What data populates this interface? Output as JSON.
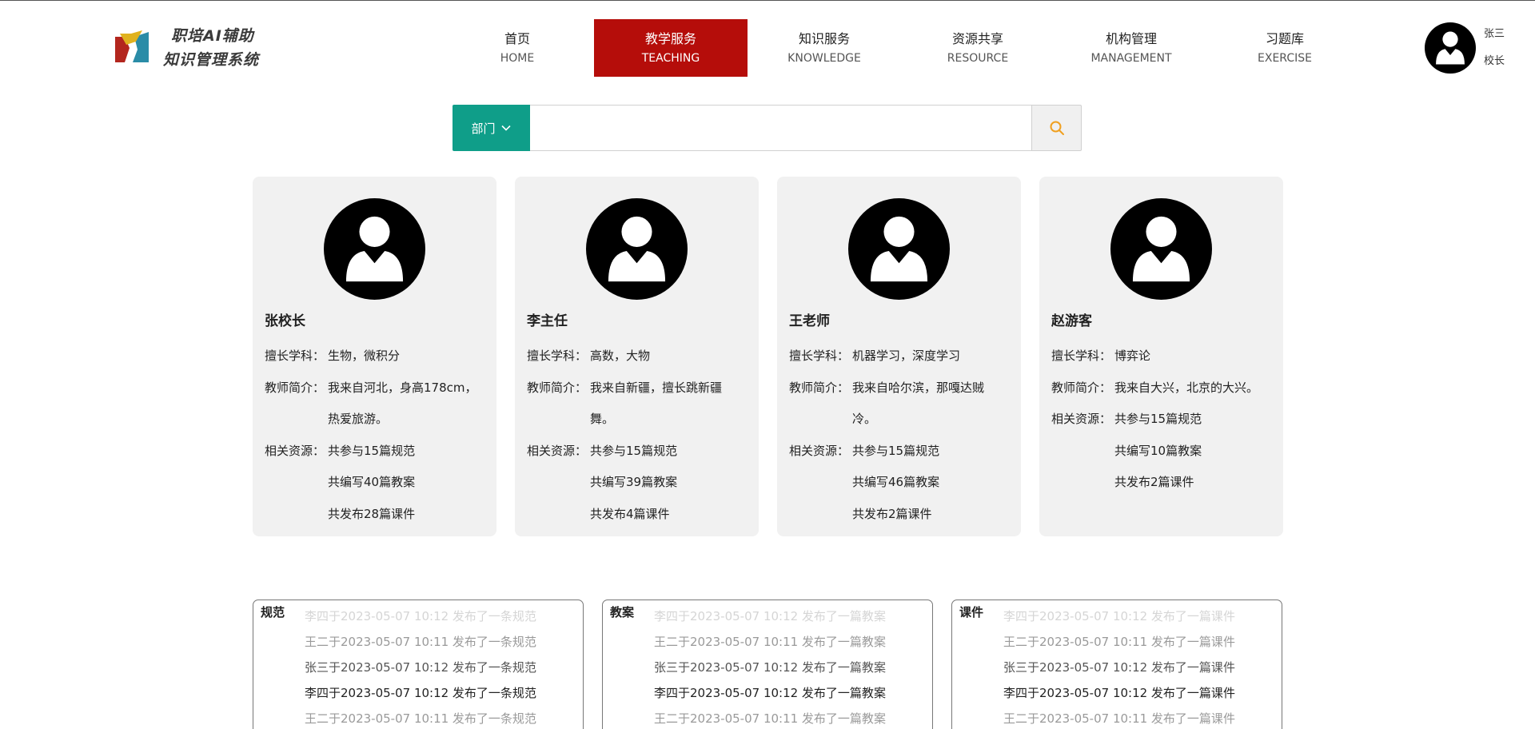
{
  "header": {
    "logo_line1": "职培AI辅助",
    "logo_line2": "知识管理系统",
    "nav": [
      {
        "zh": "首页",
        "en": "HOME"
      },
      {
        "zh": "教学服务",
        "en": "TEACHING",
        "active": true
      },
      {
        "zh": "知识服务",
        "en": "KNOWLEDGE"
      },
      {
        "zh": "资源共享",
        "en": "RESOURCE"
      },
      {
        "zh": "机构管理",
        "en": "MANAGEMENT"
      },
      {
        "zh": "习题库",
        "en": "EXERCISE"
      }
    ],
    "user": {
      "name": "张三",
      "role": "校长"
    }
  },
  "search": {
    "dept_label": "部门",
    "value": "",
    "placeholder": ""
  },
  "teachers": [
    {
      "name": "张校长",
      "subject_label": "擅长学科：",
      "subject": "生物，微积分",
      "intro_label": "教师简介：",
      "intro_lines": [
        "我来自河北，身高178cm，",
        "热爱旅游。"
      ],
      "res_label": "相关资源：",
      "resources": [
        "共参与15篇规范",
        "共编写40篇教案",
        "共发布28篇课件"
      ]
    },
    {
      "name": "李主任",
      "subject_label": "擅长学科：",
      "subject": "高数，大物",
      "intro_label": "教师简介：",
      "intro_lines": [
        "我来自新疆，擅长跳新疆",
        "舞。"
      ],
      "res_label": "相关资源：",
      "resources": [
        "共参与15篇规范",
        "共编写39篇教案",
        "共发布4篇课件"
      ]
    },
    {
      "name": "王老师",
      "subject_label": "擅长学科：",
      "subject": "机器学习，深度学习",
      "intro_label": "教师简介：",
      "intro_lines": [
        "我来自哈尔滨，那嘎达贼",
        "冷。"
      ],
      "res_label": "相关资源：",
      "resources": [
        "共参与15篇规范",
        "共编写46篇教案",
        "共发布2篇课件"
      ]
    },
    {
      "name": "赵游客",
      "subject_label": "擅长学科：",
      "subject": "博弈论",
      "intro_label": "教师简介：",
      "intro_lines": [
        "我来自大兴，北京的大兴。"
      ],
      "res_label": "相关资源：",
      "resources": [
        "共参与15篇规范",
        "共编写10篇教案",
        "共发布2篇课件"
      ]
    }
  ],
  "feeds": [
    {
      "title": "规范",
      "items": [
        "李四于2023-05-07 10:12 发布了一条规范",
        "王二于2023-05-07 10:11 发布了一条规范",
        "张三于2023-05-07 10:12 发布了一条规范",
        "李四于2023-05-07 10:12 发布了一条规范",
        "王二于2023-05-07 10:11 发布了一条规范"
      ]
    },
    {
      "title": "教案",
      "items": [
        "李四于2023-05-07 10:12 发布了一篇教案",
        "王二于2023-05-07 10:11 发布了一篇教案",
        "张三于2023-05-07 10:12 发布了一篇教案",
        "李四于2023-05-07 10:12 发布了一篇教案",
        "王二于2023-05-07 10:11 发布了一篇教案"
      ]
    },
    {
      "title": "课件",
      "items": [
        "李四于2023-05-07 10:12 发布了一篇课件",
        "王二于2023-05-07 10:11 发布了一篇课件",
        "张三于2023-05-07 10:12 发布了一篇课件",
        "李四于2023-05-07 10:12 发布了一篇课件",
        "王二于2023-05-07 10:11 发布了一篇课件"
      ]
    }
  ],
  "colors": {
    "nav_active": "#b50d0a",
    "dept_button": "#0f9e89",
    "search_icon": "#f0a020",
    "card_bg": "#f1f1f1"
  },
  "icons": {
    "logo": "logo-mark-icon",
    "avatar": "user-avatar-icon",
    "dept_chevron": "chevron-down-icon",
    "search": "search-icon"
  }
}
